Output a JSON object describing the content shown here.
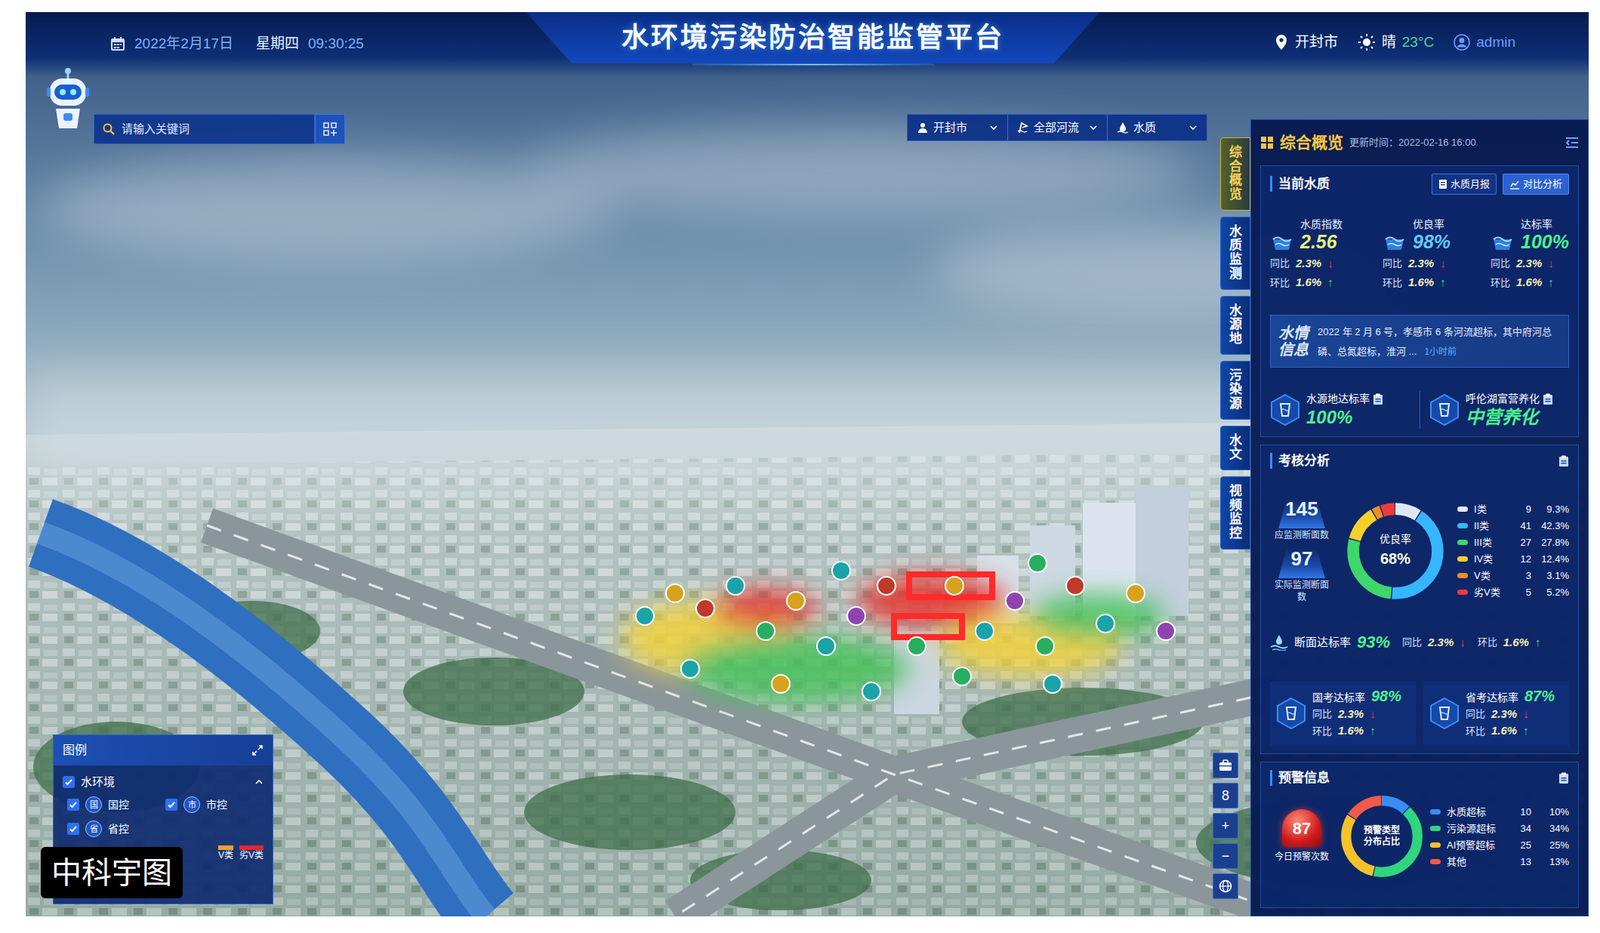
{
  "header": {
    "title": "水环境污染防治智能监管平台",
    "date": "2022年2月17日",
    "weekday": "星期四",
    "time": "09:30:25",
    "city": "开封市",
    "weather": "晴",
    "temperature": "23°C",
    "user": "admin"
  },
  "search": {
    "placeholder": "请输入关键词"
  },
  "filters": [
    {
      "label": "开封市"
    },
    {
      "label": "全部河流"
    },
    {
      "label": "水质"
    }
  ],
  "tabs": [
    {
      "label": "综合概览",
      "selected": true
    },
    {
      "label": "水质监测",
      "selected": false
    },
    {
      "label": "水源地",
      "selected": false
    },
    {
      "label": "污染源",
      "selected": false
    },
    {
      "label": "水文",
      "selected": false
    },
    {
      "label": "视频监控",
      "selected": false
    }
  ],
  "panel": {
    "title": "综合概览",
    "updated": "更新时间：2022-02-16 16:00",
    "quality": {
      "title": "当前水质",
      "buttons": [
        {
          "label": "水质月报",
          "selected": false
        },
        {
          "label": "对比分析",
          "selected": true
        }
      ],
      "metrics": [
        {
          "label": "水质指数",
          "value": "2.56",
          "color": "#e6f27a",
          "changes": [
            {
              "label": "同比",
              "value": "2.3%",
              "arrow": "↓",
              "up": false
            },
            {
              "label": "环比",
              "value": "1.6%",
              "arrow": "↑",
              "up": true
            }
          ]
        },
        {
          "label": "优良率",
          "value": "98%",
          "color": "#63c8ff",
          "changes": [
            {
              "label": "同比",
              "value": "2.3%",
              "arrow": "↓",
              "up": false
            },
            {
              "label": "环比",
              "value": "1.6%",
              "arrow": "↑",
              "up": true
            }
          ]
        },
        {
          "label": "达标率",
          "value": "100%",
          "color": "#4df08f",
          "changes": [
            {
              "label": "同比",
              "value": "2.3%",
              "arrow": "↓",
              "up": false
            },
            {
              "label": "环比",
              "value": "1.6%",
              "arrow": "↑",
              "up": true
            }
          ]
        }
      ],
      "news": {
        "title": "水情信息",
        "text": "2022 年 2 月 6 号，孝感市 6 条河流超标，其中府河总磷、总氮超标，淮河 ...",
        "time": "1小时前"
      },
      "stats": [
        {
          "label": "水源地达标率",
          "value": "100%"
        },
        {
          "label": "呼伦湖富营养化",
          "value": "中营养化"
        }
      ]
    },
    "assess": {
      "title": "考核分析",
      "counts": [
        {
          "value": "145",
          "label": "应监测断面数"
        },
        {
          "value": "97",
          "label": "实际监测断面数"
        }
      ],
      "donut": {
        "label": "优良率",
        "value": "68%"
      },
      "classes": [
        {
          "name": "I类",
          "count": "9",
          "share": "9.3%",
          "color": "#dfe8f2"
        },
        {
          "name": "II类",
          "count": "41",
          "share": "42.3%",
          "color": "#36b6ff"
        },
        {
          "name": "III类",
          "count": "27",
          "share": "27.8%",
          "color": "#3fd66b"
        },
        {
          "name": "IV类",
          "count": "12",
          "share": "12.4%",
          "color": "#f5d02a"
        },
        {
          "name": "V类",
          "count": "3",
          "share": "3.1%",
          "color": "#f28c28"
        },
        {
          "name": "劣V类",
          "count": "5",
          "share": "5.2%",
          "color": "#f03a3a"
        }
      ],
      "section_rate": {
        "label": "断面达标率",
        "value": "93%",
        "changes": [
          {
            "label": "同比",
            "value": "2.3%",
            "arrow": "↓",
            "up": false
          },
          {
            "label": "环比",
            "value": "1.6%",
            "arrow": "↑",
            "up": true
          }
        ]
      },
      "exams": [
        {
          "label": "国考达标率",
          "value": "98%",
          "changes": [
            {
              "label": "同比",
              "value": "2.3%",
              "arrow": "↓",
              "up": false
            },
            {
              "label": "环比",
              "value": "1.6%",
              "arrow": "↑",
              "up": true
            }
          ]
        },
        {
          "label": "省考达标率",
          "value": "87%",
          "changes": [
            {
              "label": "同比",
              "value": "2.3%",
              "arrow": "↓",
              "up": false
            },
            {
              "label": "环比",
              "value": "1.6%",
              "arrow": "↑",
              "up": true
            }
          ]
        }
      ]
    },
    "warning": {
      "title": "预警信息",
      "count": "87",
      "count_label": "今日预警次数",
      "donut_label": "预警类型分布占比",
      "types": [
        {
          "name": "水质超标",
          "count": "10",
          "share": "10%",
          "color": "#3a8df5"
        },
        {
          "name": "污染源超标",
          "count": "34",
          "share": "34%",
          "color": "#2fd67c"
        },
        {
          "name": "AI预警超标",
          "count": "25",
          "share": "25%",
          "color": "#f5c22a"
        },
        {
          "name": "其他",
          "count": "13",
          "share": "13%",
          "color": "#f25a4a"
        }
      ]
    }
  },
  "legend": {
    "title": "图例",
    "group": {
      "label": "水环境",
      "checked": true,
      "expanded": true
    },
    "items": [
      {
        "badge": "国",
        "label": "国控",
        "checked": true
      },
      {
        "badge": "市",
        "label": "市控",
        "checked": true
      },
      {
        "badge": "省",
        "label": "省控",
        "checked": true
      }
    ],
    "scale": [
      {
        "label": "V类",
        "color": "#f0a030"
      },
      {
        "label": "劣V类",
        "color": "#e8252c"
      }
    ]
  },
  "map_controls": {
    "buttons": [
      "8",
      "+",
      "−"
    ]
  },
  "watermark": "中科宇图"
}
